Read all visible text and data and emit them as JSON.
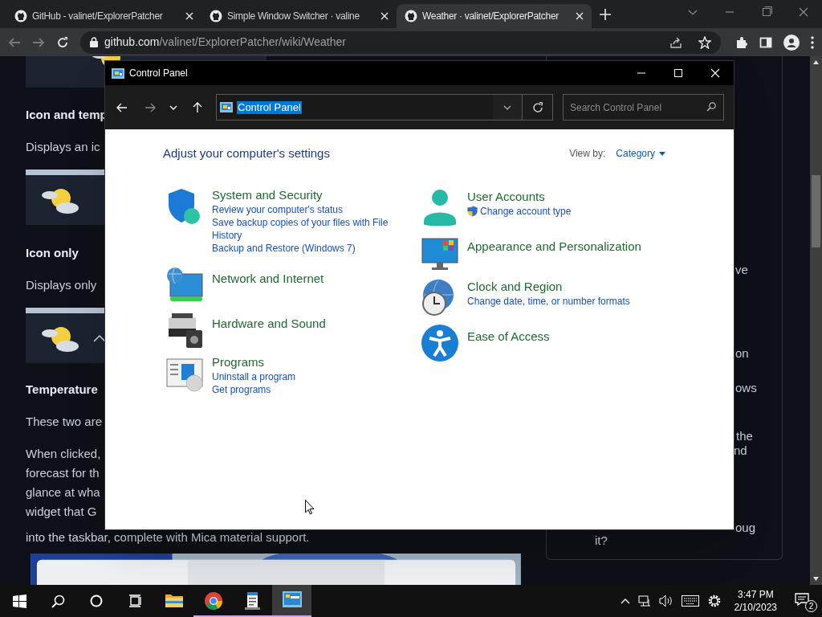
{
  "browser": {
    "tabs": [
      {
        "title": "GitHub - valinet/ExplorerPatcher",
        "selected": false
      },
      {
        "title": "Simple Window Switcher · valine",
        "selected": false
      },
      {
        "title": "Weather · valinet/ExplorerPatcher",
        "selected": true
      }
    ],
    "address": {
      "host": "github.com",
      "path": "/valinet/ExplorerPatcher/wiki/Weather"
    }
  },
  "page": {
    "blocks": [
      {
        "kind": "card-top"
      },
      {
        "kind": "heading",
        "text": "Icon and temp"
      },
      {
        "kind": "text",
        "text": "Displays an ic"
      },
      {
        "kind": "card"
      },
      {
        "kind": "heading",
        "text": "Icon only"
      },
      {
        "kind": "text",
        "text": "Displays only"
      },
      {
        "kind": "card-chevron"
      },
      {
        "kind": "heading",
        "text": "Temperature"
      },
      {
        "kind": "text",
        "text": "These two are"
      },
      {
        "kind": "paragraph",
        "lines": [
          "When clicked,",
          "forecast for th",
          "glance at wha",
          "widget that G",
          "into the taskbar, complete with Mica material support."
        ]
      },
      {
        "kind": "picture"
      }
    ],
    "side_fragments": [
      "ve",
      "on",
      "ows",
      "the",
      "nd",
      "oug",
      "it?"
    ]
  },
  "control_panel": {
    "title": "Control Panel",
    "address": "Control Panel",
    "search_placeholder": "Search Control Panel",
    "heading": "Adjust your computer's settings",
    "view_by_label": "View by:",
    "view_by_value": "Category",
    "columns": [
      [
        {
          "title": "System and Security",
          "links": [
            {
              "text": "Review your computer's status",
              "shield": false
            },
            {
              "text": "Save backup copies of your files with File History",
              "shield": false
            },
            {
              "text": "Backup and Restore (Windows 7)",
              "shield": false
            }
          ]
        },
        {
          "title": "Network and Internet"
        },
        {
          "title": "Hardware and Sound"
        },
        {
          "title": "Programs",
          "links": [
            {
              "text": "Uninstall a program",
              "shield": false
            },
            {
              "text": "Get programs",
              "shield": false
            }
          ]
        }
      ],
      [
        {
          "title": "User Accounts",
          "links": [
            {
              "text": "Change account type",
              "shield": true
            }
          ]
        },
        {
          "title": "Appearance and Personalization"
        },
        {
          "title": "Clock and Region",
          "links": [
            {
              "text": "Change date, time, or number formats",
              "shield": false
            }
          ]
        },
        {
          "title": "Ease of Access"
        }
      ]
    ]
  },
  "taskbar": {
    "apps": [
      {
        "kind": "explorer",
        "running": false,
        "active": false
      },
      {
        "kind": "chrome",
        "running": true,
        "active": false
      },
      {
        "kind": "notepad",
        "running": true,
        "active": false
      },
      {
        "kind": "controlpanel",
        "running": true,
        "active": true
      }
    ],
    "time": "3:47 PM",
    "date": "2/10/2023",
    "notifications": "2"
  }
}
